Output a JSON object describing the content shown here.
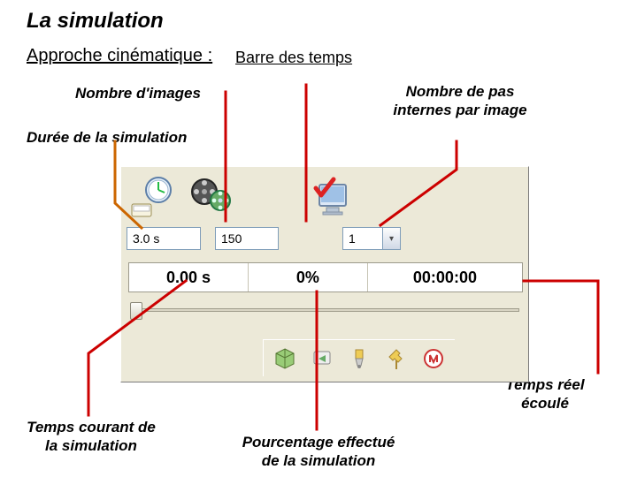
{
  "title": "La simulation",
  "subtitle_a": "Approche cinématique : ",
  "subtitle_b": "Barre des temps",
  "labels": {
    "nb_images": "Nombre d'images",
    "duree": "Durée de la simulation",
    "nb_pas": "Nombre de pas internes par image",
    "temps_reel": "Temps réel écoulé",
    "temps_courant": "Temps courant de la simulation",
    "pourcentage": "Pourcentage effectué de la simulation"
  },
  "inputs": {
    "duration": "3.0 s",
    "frames": "150",
    "steps": "1"
  },
  "status": {
    "current_time": "0.00 s",
    "percent": "0%",
    "elapsed": "00:00:00"
  },
  "icon_names": {
    "clock": "clock-icon",
    "film": "film-reel-icon",
    "monitor": "monitor-check-icon"
  },
  "tool_icons": [
    "cube-icon",
    "rewind-icon",
    "tool-icon",
    "pin-icon",
    "logo-icon"
  ]
}
